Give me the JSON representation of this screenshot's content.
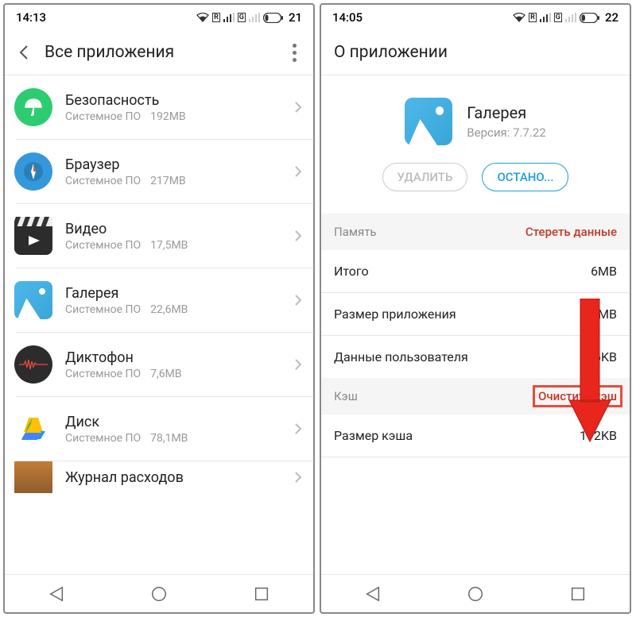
{
  "screen1": {
    "status": {
      "time": "14:13",
      "net_r": "R",
      "net_g": "G",
      "battery": "21"
    },
    "title": "Все приложения",
    "apps": [
      {
        "name": "Безопасность",
        "type": "Системное ПО",
        "size": "192MB",
        "icon": "umbrella",
        "bg": "#2ecc71"
      },
      {
        "name": "Браузер",
        "type": "Системное ПО",
        "size": "217MB",
        "icon": "compass",
        "bg": "#3498db"
      },
      {
        "name": "Видео",
        "type": "Системное ПО",
        "size": "17,5MB",
        "icon": "clapper",
        "bg": "#222"
      },
      {
        "name": "Галерея",
        "type": "Системное ПО",
        "size": "22,6MB",
        "icon": "gallery",
        "bg": "#4db8e8"
      },
      {
        "name": "Диктофон",
        "type": "Системное ПО",
        "size": "7,6MB",
        "icon": "recorder",
        "bg": "#2c2c2c"
      },
      {
        "name": "Диск",
        "type": "Системное ПО",
        "size": "78,1MB",
        "icon": "drive",
        "bg": "#fff"
      },
      {
        "name": "Журнал расходов",
        "type": "",
        "size": "",
        "icon": "wallet",
        "bg": "#8b5a2b"
      }
    ]
  },
  "screen2": {
    "status": {
      "time": "14:05",
      "net_r": "R",
      "net_g": "G",
      "battery": "22"
    },
    "title": "О приложении",
    "app": {
      "name": "Галерея",
      "version_label": "Версия: 7.7.22"
    },
    "buttons": {
      "delete": "УДАЛИТЬ",
      "stop": "ОСТАНО..."
    },
    "sections": {
      "memory": {
        "label": "Память",
        "action": "Стереть данные"
      },
      "cache": {
        "label": "Кэш",
        "action": "Очистить кэш"
      }
    },
    "rows": {
      "total": {
        "k": "Итого",
        "v": "6MB"
      },
      "appsize": {
        "k": "Размер приложения",
        "v": "MB"
      },
      "userdata": {
        "k": "Данные пользователя",
        "v": "96KB"
      },
      "cachesize": {
        "k": "Размер кэша",
        "v": "112KB"
      }
    }
  }
}
